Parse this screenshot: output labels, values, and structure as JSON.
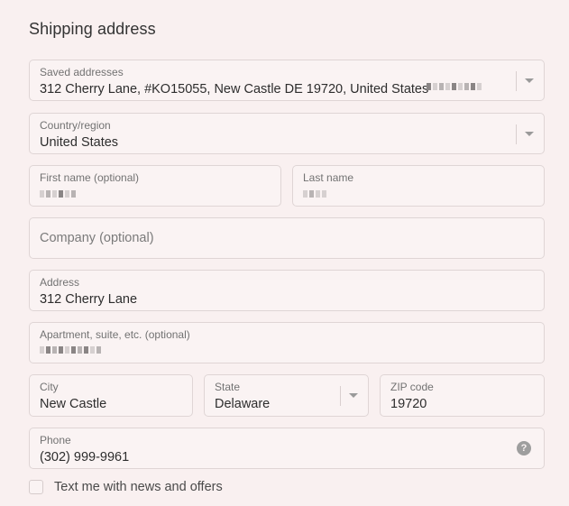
{
  "section_title": "Shipping address",
  "saved_addresses": {
    "label": "Saved addresses",
    "value": "312 Cherry Lane, #KO15055, New Castle DE 19720, United States"
  },
  "country": {
    "label": "Country/region",
    "value": "United States"
  },
  "first_name": {
    "label": "First name (optional)"
  },
  "last_name": {
    "label": "Last name"
  },
  "company": {
    "placeholder": "Company (optional)"
  },
  "address": {
    "label": "Address",
    "value": "312 Cherry Lane"
  },
  "apartment": {
    "label": "Apartment, suite, etc. (optional)"
  },
  "city": {
    "label": "City",
    "value": "New Castle"
  },
  "state": {
    "label": "State",
    "value": "Delaware"
  },
  "zip": {
    "label": "ZIP code",
    "value": "19720"
  },
  "phone": {
    "label": "Phone",
    "value": "(302) 999-9961",
    "help_icon": "question-circle-icon",
    "help_glyph": "?"
  },
  "marketing": {
    "label": "Text me with news and offers",
    "checked": false
  }
}
